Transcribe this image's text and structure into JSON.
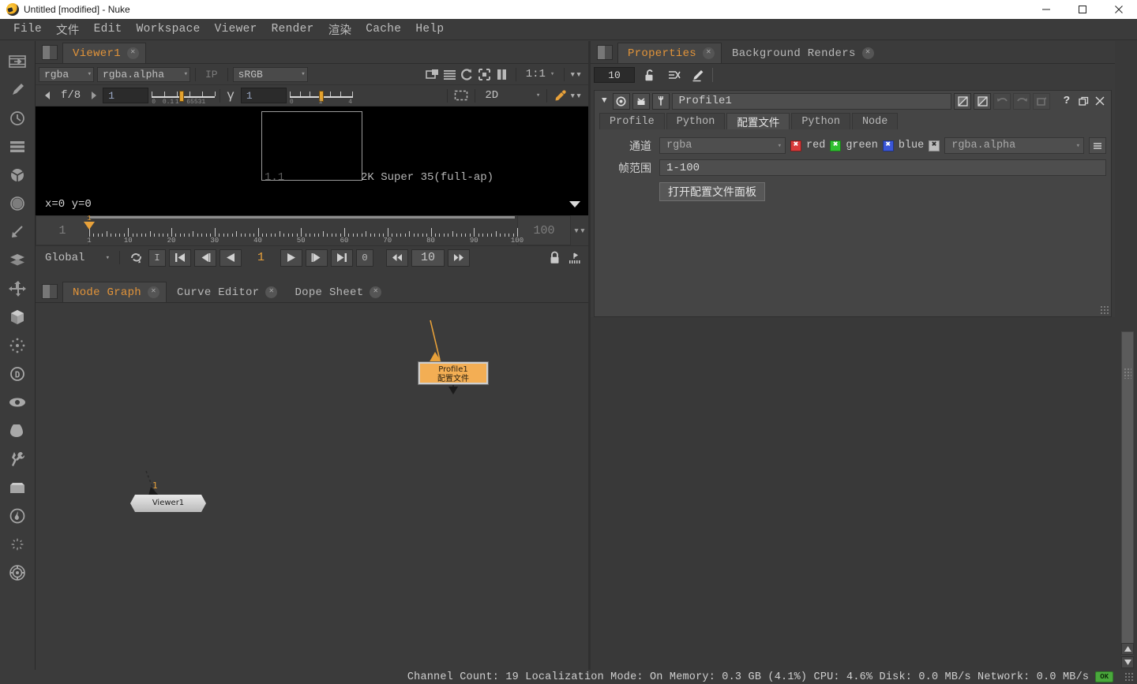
{
  "window": {
    "title": "Untitled [modified] - Nuke",
    "icon": "nuke-logo-icon",
    "minimize": "minimize-icon",
    "maximize": "maximize-icon",
    "close": "close-icon"
  },
  "menubar": {
    "items": [
      "File",
      "文件",
      "Edit",
      "Workspace",
      "Viewer",
      "Render",
      "渲染",
      "Cache",
      "Help"
    ]
  },
  "left_toolbar": {
    "items": [
      {
        "name": "image-icon",
        "glyph": "image"
      },
      {
        "name": "draw-icon",
        "glyph": "draw"
      },
      {
        "name": "time-icon",
        "glyph": "clock"
      },
      {
        "name": "channel-icon",
        "glyph": "bars"
      },
      {
        "name": "color-icon",
        "glyph": "colorwheel"
      },
      {
        "name": "filter-icon",
        "glyph": "dot-circle"
      },
      {
        "name": "keyer-icon",
        "glyph": "keyer"
      },
      {
        "name": "merge-icon",
        "glyph": "layers"
      },
      {
        "name": "transform-icon",
        "glyph": "move"
      },
      {
        "name": "3d-icon",
        "glyph": "cube"
      },
      {
        "name": "particles-icon",
        "glyph": "spark"
      },
      {
        "name": "deep-icon",
        "glyph": "d-circle"
      },
      {
        "name": "views-icon",
        "glyph": "eye"
      },
      {
        "name": "metadata-icon",
        "glyph": "tag"
      },
      {
        "name": "toolsets-icon",
        "glyph": "wrench"
      },
      {
        "name": "other-icon",
        "glyph": "box"
      },
      {
        "name": "furnace-icon",
        "glyph": "flame"
      },
      {
        "name": "cara-vr-icon",
        "glyph": "burst"
      },
      {
        "name": "plugins-icon",
        "glyph": "gear-circle"
      }
    ]
  },
  "viewer": {
    "tabs": [
      {
        "label": "Viewer1",
        "active": true,
        "close": "close-icon"
      }
    ],
    "channel_select": "rgba",
    "layer_select": "rgba.alpha",
    "ip_label": "IP",
    "colorspace": "sRGB",
    "zoom_level": "1:1",
    "toolbar_icons": [
      {
        "name": "proxy-icon"
      },
      {
        "name": "compare-icon"
      },
      {
        "name": "refresh-icon"
      },
      {
        "name": "roi-icon"
      },
      {
        "name": "pause-icon"
      }
    ],
    "gain_prev": "left-arrow-icon",
    "gain_label": "f/8",
    "gain_next": "right-arrow-icon",
    "gain_value": "1",
    "gain_ticks": [
      "0",
      "0.1",
      "1",
      "65531"
    ],
    "gamma_symbol": "γ",
    "gamma_value": "1",
    "gamma_ticks": [
      "0",
      "1",
      "4"
    ],
    "roi_icon": "roi-dashed-icon",
    "view_mode": "2D",
    "eyedropper_icon": "eyedropper-icon",
    "viewport": {
      "bottom_left_label": "1.1",
      "format_label": "2K Super 35(full-ap)"
    },
    "coords": "x=0  y=0",
    "timeline": {
      "in_frame": "1",
      "out_frame": "100",
      "playhead_frame": "1",
      "tick_labels": [
        "1",
        "10",
        "20",
        "30",
        "40",
        "50",
        "60",
        "70",
        "80",
        "90",
        "100"
      ],
      "tick_values": [
        1,
        10,
        20,
        30,
        40,
        50,
        60,
        70,
        80,
        90,
        100
      ],
      "range_min": 1,
      "range_max": 100
    },
    "transport": {
      "scope": "Global",
      "loop_icon": "loop-icon",
      "buttons": [
        {
          "name": "set-in-point-button",
          "glyph": "I"
        },
        {
          "name": "first-frame-button",
          "glyph": "skip-back"
        },
        {
          "name": "previous-keyframe-button",
          "glyph": "step-back"
        },
        {
          "name": "play-backward-button",
          "glyph": "play-back"
        }
      ],
      "current_frame": "1",
      "buttons_right": [
        {
          "name": "play-forward-button",
          "glyph": "play"
        },
        {
          "name": "next-keyframe-button",
          "glyph": "step-fwd"
        },
        {
          "name": "last-frame-button",
          "glyph": "skip-fwd"
        },
        {
          "name": "frame-increment-button",
          "glyph": "0"
        }
      ],
      "fps_back_icon": "rewind-icon",
      "fps": "10",
      "fps_fwd_icon": "fastforward-icon",
      "lock_icon": "lock-icon",
      "key-icon": "keyframe-icon"
    }
  },
  "node_graph": {
    "tabs": [
      {
        "label": "Node Graph",
        "active": true,
        "close": "close-icon"
      },
      {
        "label": "Curve Editor",
        "active": false,
        "close": "close-icon"
      },
      {
        "label": "Dope Sheet",
        "active": false,
        "close": "close-icon"
      }
    ],
    "nodes": [
      {
        "name": "Profile1",
        "subtitle": "配置文件",
        "color": "#f3ae54",
        "selected": true
      },
      {
        "name": "Viewer1",
        "subtitle": "",
        "color": "#d0d0d0",
        "selected": false
      }
    ],
    "connection_label": "1"
  },
  "properties": {
    "tabs": [
      {
        "label": "Properties",
        "active": true,
        "close": "close-icon"
      },
      {
        "label": "Background Renders",
        "active": false,
        "close": "close-icon"
      }
    ],
    "max_panels": "10",
    "toolbar_icons": [
      {
        "name": "unlock-icon"
      },
      {
        "name": "remove-all-icon"
      },
      {
        "name": "edit-icon"
      }
    ],
    "knob_panel": {
      "collapse_icon": "triangle-down-icon",
      "header_icons": [
        {
          "name": "node-color-icon"
        },
        {
          "name": "tv-icon"
        },
        {
          "name": "wrench-icon"
        }
      ],
      "node_name": "Profile1",
      "right_icons": [
        {
          "name": "mask-a-icon"
        },
        {
          "name": "mask-b-icon"
        },
        {
          "name": "undo-icon",
          "disabled": true
        },
        {
          "name": "redo-icon",
          "disabled": true
        },
        {
          "name": "revert-icon",
          "disabled": true
        },
        {
          "name": "help-icon"
        },
        {
          "name": "float-icon"
        },
        {
          "name": "close-icon"
        }
      ],
      "tabs": [
        {
          "label": "Profile",
          "active": false
        },
        {
          "label": "Python",
          "active": false
        },
        {
          "label": "配置文件",
          "active": true
        },
        {
          "label": "Python",
          "active": false
        },
        {
          "label": "Node",
          "active": false
        }
      ],
      "rows": {
        "channels_label": "通道",
        "channels_value": "rgba",
        "channel_checks": [
          {
            "label": "red",
            "color": "#d83a3a",
            "checked": true
          },
          {
            "label": "green",
            "color": "#2fc02f",
            "checked": true
          },
          {
            "label": "blue",
            "color": "#3a56d8",
            "checked": true
          },
          {
            "label": "",
            "color": "#bdbdbd",
            "checked": true
          }
        ],
        "alpha_value": "rgba.alpha",
        "menu_icon": "hamburger-icon",
        "framerange_label": "帧范围",
        "framerange_value": "1-100",
        "open_panel_button": "打开配置文件面板"
      }
    }
  },
  "statusbar": {
    "text": "Channel Count: 19 Localization Mode: On Memory: 0.3 GB (4.1%) CPU: 4.6% Disk: 0.0 MB/s Network: 0.0 MB/s",
    "badge": "OK",
    "badge_color": "#4aa83c"
  }
}
